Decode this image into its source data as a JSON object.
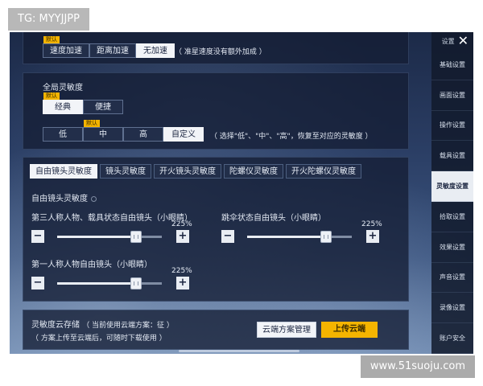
{
  "watermarks": {
    "top_left": "TG: MYYJJPP",
    "bottom_right": "www.51suoju.com"
  },
  "sidebar": {
    "title": "设置",
    "items": [
      {
        "label": "基础设置",
        "active": false
      },
      {
        "label": "画面设置",
        "active": false
      },
      {
        "label": "操作设置",
        "active": false
      },
      {
        "label": "载具设置",
        "active": false
      },
      {
        "label": "灵敏度设置",
        "active": true
      },
      {
        "label": "拾取设置",
        "active": false
      },
      {
        "label": "效果设置",
        "active": false
      },
      {
        "label": "声音设置",
        "active": false
      },
      {
        "label": "录像设置",
        "active": false
      },
      {
        "label": "账户安全",
        "active": false
      }
    ]
  },
  "speed": {
    "default_badge": "默认",
    "options": [
      "速度加速",
      "距离加速",
      "无加速"
    ],
    "selected": "无加速",
    "hint": "（ 准星速度没有额外加成 ）"
  },
  "global": {
    "title": "全局灵敏度",
    "default_badge": "默认",
    "mode_options": [
      "经典",
      "便捷"
    ],
    "mode_selected": "经典",
    "level_badge": "默认",
    "level_options": [
      "低",
      "中",
      "高",
      "自定义"
    ],
    "level_selected": "自定义",
    "level_hint": "（ 选择\"低\"、\"中\"、\"高\"，恢复至对应的灵敏度 ）"
  },
  "camera": {
    "tabs": [
      "自由镜头灵敏度",
      "镜头灵敏度",
      "开火镜头灵敏度",
      "陀螺仪灵敏度",
      "开火陀螺仪灵敏度"
    ],
    "active_tab": "自由镜头灵敏度",
    "section_title": "自由镜头灵敏度",
    "sliders": [
      {
        "label": "第三人称人物、载具状态自由镜头（小眼睛）",
        "value": "225%",
        "fraction": 0.75
      },
      {
        "label": "跳伞状态自由镜头（小眼睛）",
        "value": "225%",
        "fraction": 0.75
      },
      {
        "label": "第一人称人物自由镜头（小眼睛）",
        "value": "225%",
        "fraction": 0.75
      }
    ],
    "minus": "−",
    "plus": "+"
  },
  "cloud": {
    "title": "灵敏度云存储",
    "current_scheme": "（ 当前使用云端方案：征 ）",
    "subtitle": "（ 方案上传至云端后，可随时下载使用 ）",
    "manage_label": "云端方案管理",
    "upload_label": "上传云端"
  },
  "colors": {
    "accent": "#f4b400",
    "selected_bg": "#f2f4f8",
    "panel_bg": "#141e34"
  }
}
